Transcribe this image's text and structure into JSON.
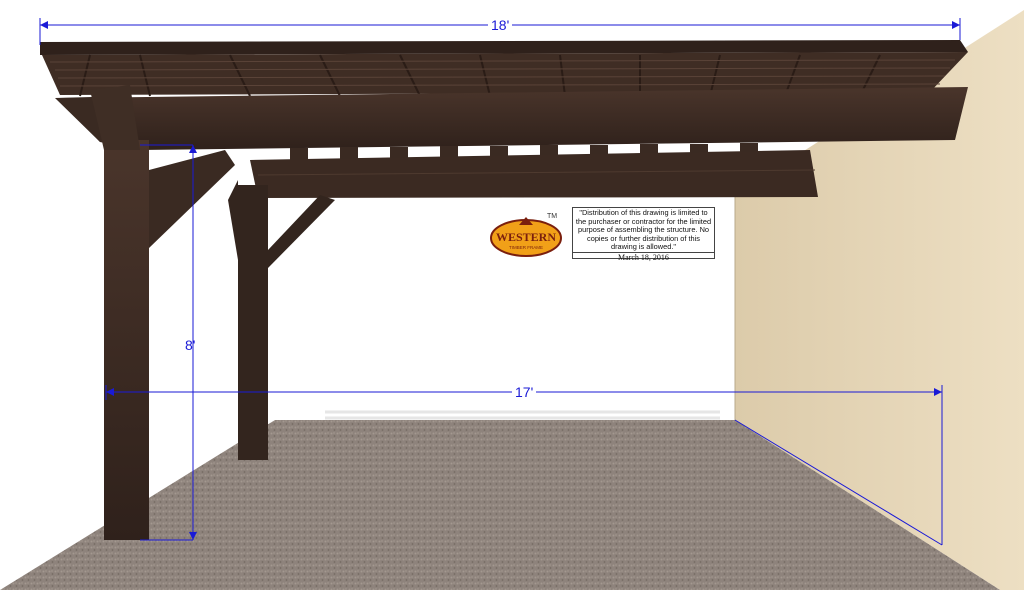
{
  "dimensions": {
    "width_label": "18'",
    "depth_label": "17'",
    "height_label": "8'"
  },
  "logo": {
    "brand": "WESTERN",
    "sub": "TIMBER FRAME",
    "trademark": "TM"
  },
  "notice": {
    "text": "\"Distribution of this drawing is limited to the purchaser or contractor for the limited purpose of assembling the structure.  No copies or further distribution of this drawing is allowed.\"",
    "date": "March 18, 2016"
  },
  "colors": {
    "timber": "#3b2a22",
    "wall": "#e8d9bc",
    "ground": "#8c7f78",
    "dimension": "#1a1ad6",
    "logo_fill": "#f1a018",
    "logo_text": "#7a1f0e"
  }
}
